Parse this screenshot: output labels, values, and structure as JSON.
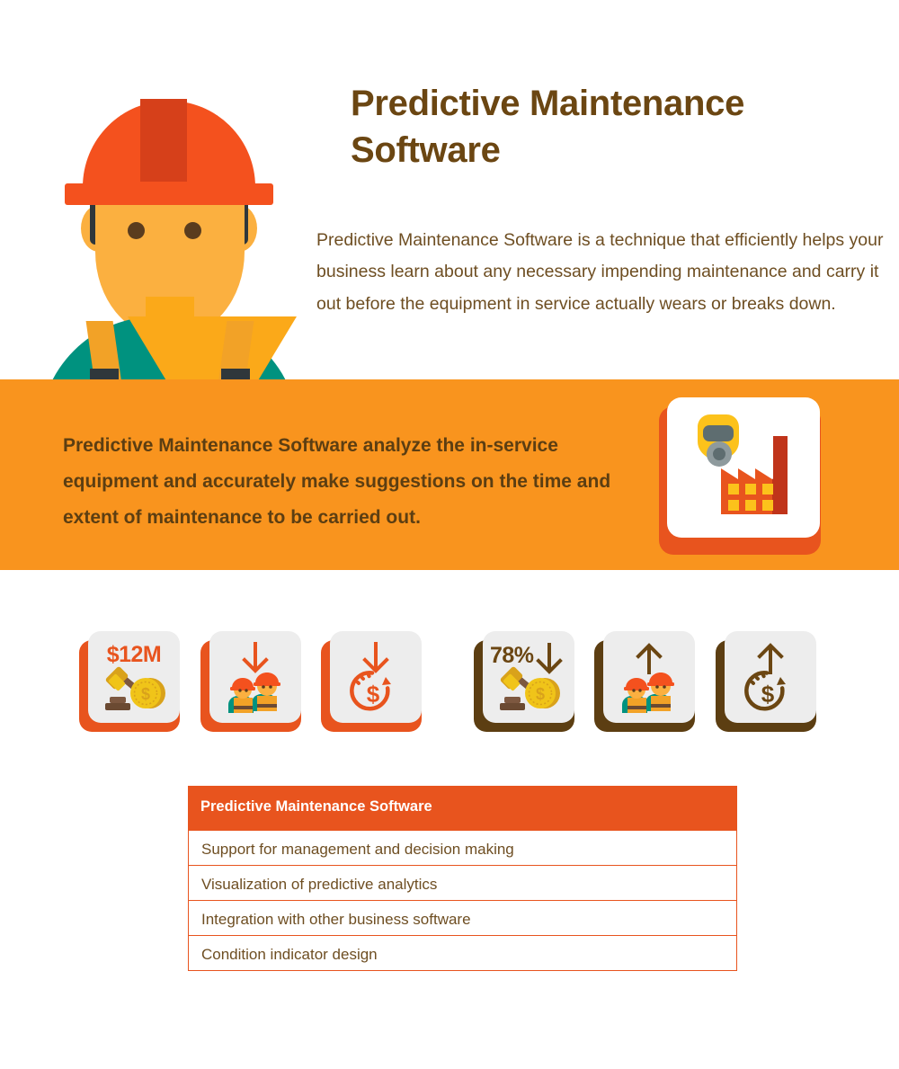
{
  "hero": {
    "title": "Predictive Maintenance Software",
    "paragraph": "Predictive Maintenance Software is a technique that efficiently helps your business learn about any necessary impending maintenance and carry it out before the equipment in service actually wears or breaks down.",
    "illustration_name": "construction-worker-illustration"
  },
  "banner": {
    "text": "Predictive Maintenance Software analyze the in-service equipment and accurately make suggestions on the time and extent of maintenance to be carried out.",
    "icon": "factory-with-gas-mask-icon",
    "background_color": "#F9941E",
    "text_color": "#5C3E12",
    "card_shadow_color": "#E8541E"
  },
  "metrics": {
    "groups": [
      {
        "accent_color": "#E8541E",
        "shadow_style": "orange",
        "tiles": [
          {
            "value": "$12M",
            "value_position": "center",
            "arrow": "none",
            "icon": "gavel-and-coin-icon",
            "accent": "orange"
          },
          {
            "value": "",
            "value_position": "none",
            "arrow": "down",
            "icon": "two-workers-icon",
            "accent": "orange"
          },
          {
            "value": "",
            "value_position": "none",
            "arrow": "down",
            "icon": "recurring-cost-dollar-icon",
            "accent": "orange"
          }
        ]
      },
      {
        "accent_color": "#6B4612",
        "shadow_style": "brown",
        "tiles": [
          {
            "value": "78%",
            "value_position": "left",
            "arrow": "down",
            "icon": "gavel-and-coin-icon",
            "accent": "brown"
          },
          {
            "value": "",
            "value_position": "none",
            "arrow": "up",
            "icon": "two-workers-icon",
            "accent": "brown"
          },
          {
            "value": "",
            "value_position": "none",
            "arrow": "up",
            "icon": "recurring-cost-dollar-icon",
            "accent": "brown"
          }
        ]
      }
    ]
  },
  "table": {
    "header": "Predictive Maintenance Software",
    "header_bg": "#E8541E",
    "border_color": "#E8541E",
    "rows": [
      "Support for management and decision making",
      "Visualization of predictive analytics",
      "Integration with other business software",
      "Condition indicator design"
    ]
  }
}
